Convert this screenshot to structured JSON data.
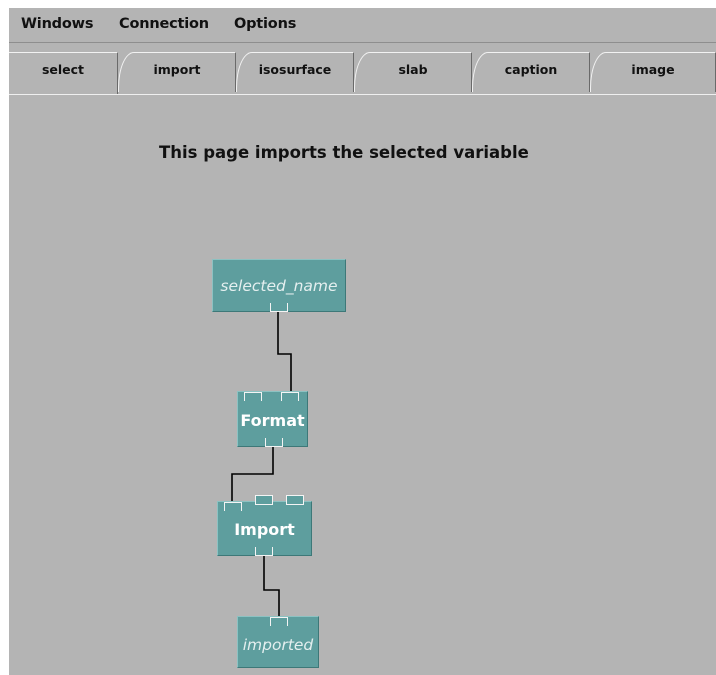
{
  "menubar": {
    "items": [
      {
        "id": "windows",
        "label": "Windows"
      },
      {
        "id": "connection",
        "label": "Connection"
      },
      {
        "id": "options",
        "label": "Options"
      }
    ]
  },
  "tabs": [
    {
      "id": "select",
      "label": "select"
    },
    {
      "id": "import",
      "label": "import"
    },
    {
      "id": "isosurface",
      "label": "isosurface"
    },
    {
      "id": "slab",
      "label": "slab"
    },
    {
      "id": "caption",
      "label": "caption"
    },
    {
      "id": "image",
      "label": "image"
    }
  ],
  "page": {
    "heading": "This page imports the selected variable"
  },
  "network": {
    "nodes": {
      "selected_name": {
        "label": "selected_name"
      },
      "format": {
        "label": "Format"
      },
      "import": {
        "label": "Import"
      },
      "imported": {
        "label": "imported"
      }
    }
  },
  "colors": {
    "background": "#b4b4b4",
    "node_fill": "#5e9e9e",
    "wire": "#000000"
  }
}
